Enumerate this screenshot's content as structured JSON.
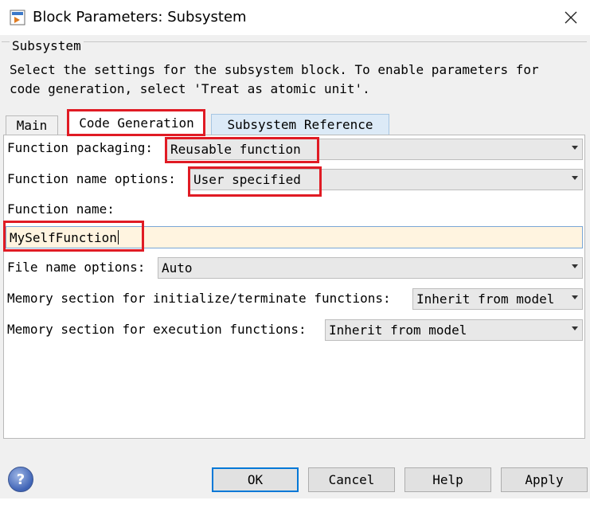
{
  "window": {
    "title": "Block Parameters: Subsystem",
    "close_glyph": "✕"
  },
  "group": {
    "title": "Subsystem",
    "description_line1": "Select the settings for the subsystem block. To enable parameters for",
    "description_line2": "code generation, select 'Treat as atomic unit'."
  },
  "tabs": [
    {
      "label": "Main",
      "selected": false
    },
    {
      "label": "Code Generation",
      "selected": true
    },
    {
      "label": "Subsystem Reference",
      "selected": false
    }
  ],
  "fields": {
    "function_packaging": {
      "label": "Function packaging:",
      "value": "Reusable function"
    },
    "function_name_options": {
      "label": "Function name options:",
      "value": "User specified"
    },
    "function_name": {
      "label": "Function name:",
      "value": "MySelfFunction"
    },
    "file_name_options": {
      "label": "File name options:",
      "value": "Auto"
    },
    "memory_init_term": {
      "label": "Memory section for initialize/terminate functions:",
      "value": "Inherit from model"
    },
    "memory_exec": {
      "label": "Memory section for execution functions:",
      "value": "Inherit from model"
    }
  },
  "buttons": {
    "help": "?",
    "ok": "OK",
    "cancel": "Cancel",
    "help_label": "Help",
    "apply": "Apply"
  },
  "colors": {
    "highlight": "#e01b24",
    "dialog_bg": "#f0f0f0",
    "text_field_bg": "#fff4e0",
    "focus_border": "#0078d7"
  },
  "icons": {
    "app": "simulink-block-icon",
    "close": "close-icon",
    "help": "help-icon",
    "dropdown": "chevron-down-icon"
  }
}
